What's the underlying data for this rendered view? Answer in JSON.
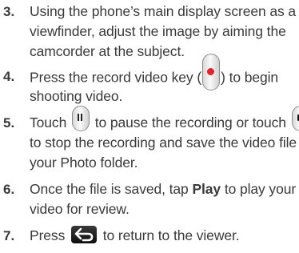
{
  "steps": [
    {
      "number": "3.",
      "lines": [
        "Using the phone’s main display screen as a",
        "viewfinder, adjust the image by aiming the",
        "camcorder at the subject."
      ]
    },
    {
      "number": "4.",
      "line1_before": "Press the record video key (",
      "line1_after": ") to begin",
      "line2": "shooting video.",
      "icon": "record-video-key-icon"
    },
    {
      "number": "5.",
      "line1_before": "Touch",
      "line1_after": "to pause the recording or touch",
      "line2": "to stop the recording and save the video file to",
      "line3": "your Photo folder.",
      "icons": [
        "pause-key-icon",
        "stop-key-icon"
      ]
    },
    {
      "number": "6.",
      "line1_before": "Once the file is saved, tap",
      "line1_bold": "Play",
      "line1_after": "to play your",
      "line2": "video for review."
    },
    {
      "number": "7.",
      "line1_before": "Press",
      "line1_after": "to return to the viewer.",
      "icon": "back-key-icon"
    }
  ],
  "colors": {
    "text": "#3a3a3a",
    "record_dot": "#e8202a",
    "back_key": "#1a1a1a"
  }
}
